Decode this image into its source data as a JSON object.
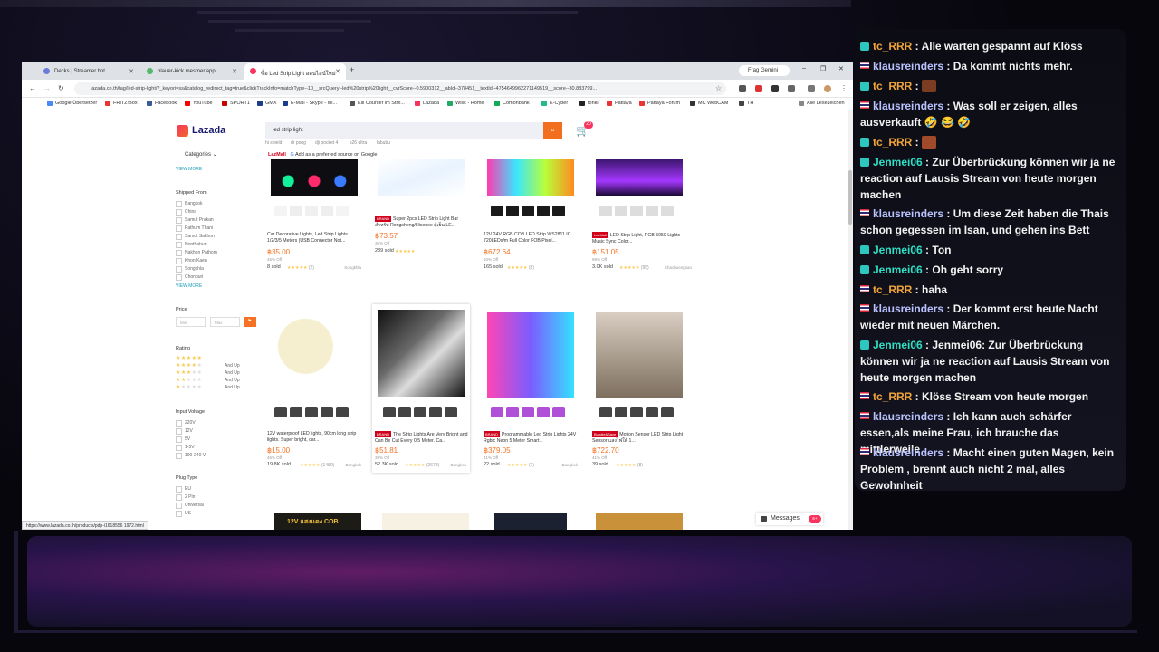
{
  "browser": {
    "tabs": [
      {
        "label": "Decks | Streamer.bot"
      },
      {
        "label": "blauer-kick.mesmer.app"
      },
      {
        "label": "ซื้อ Led Strip Light ออนไลน์ใหม่"
      }
    ],
    "new_tab": "+",
    "frag": "Frag Gemini",
    "window_controls": [
      "–",
      "❐",
      "✕"
    ],
    "url": "lazada.co.th/tag/led-strip-light/?_keyori=ss&catalog_redirect_tag=true&clickTrackInfo=matchType--10__srcQuery--led%20strip%20light__cvrScore--0.5900312__abId--378451__textId--4754649962271149519__score--30.883799...",
    "bookmarks": [
      "Google Übersetzer",
      "FRITZ!Box",
      "Facebook",
      "YouTube",
      "SPORT1",
      "GMX",
      "E-Mail - Skype - Mi...",
      "Kill Counter im Stre...",
      "Lazada",
      "Wisc - Home",
      "Comonbank",
      "K-Cyber",
      "fonkil",
      "Pattaya",
      "Pattaya Forum",
      "MC WebCAM",
      "TH"
    ],
    "bookmarks_all": "Alle Lesezeichen",
    "status_url": "https://www.lazada.co.th/products/pdp-i1618556 1972.html"
  },
  "lazada": {
    "logo": "Lazada",
    "search_value": "led strip light",
    "search_suggestions": [
      "hi shield",
      "dr pong",
      "dji pocket 4",
      "s26 ultra",
      "labubu"
    ],
    "categories": "Categories",
    "view_more": "VIEW MORE",
    "lazmall": "LazMall",
    "google_note": "Add as a preferred source on Google",
    "shipped_from": {
      "title": "Shipped From",
      "options": [
        "Bangkok",
        "China",
        "Samut Prakan",
        "Pathum Thani",
        "Samut Sakhon",
        "Nonthaburi",
        "Nakhon Pathom",
        "Khon Kaen",
        "Songkhla",
        "Chonburi"
      ]
    },
    "price": {
      "title": "Price",
      "min": "Min",
      "max": "Max",
      "go": "▸"
    },
    "rating": {
      "title": "Rating",
      "and_up": "And Up"
    },
    "input_voltage": {
      "title": "Input Voltage",
      "options": [
        "220V",
        "12V",
        "5V",
        "1-5V",
        "100-240 V"
      ]
    },
    "plug_type": {
      "title": "Plug Type",
      "options": [
        "EU",
        "2 Pin",
        "Universal",
        "US"
      ]
    },
    "cart_count": "20",
    "messages": {
      "label": "Messages",
      "count": "6+"
    },
    "products": [
      {
        "name": "Car Decorative Lights, Led Strip Lights 1/2/3/5 Meters (USB Connector Not...",
        "price": "฿35.00",
        "off": "45% Off",
        "sold": "8 sold",
        "reviews": "(2)",
        "loc": "Songkhla",
        "badge": ""
      },
      {
        "name": "Super 2pcs LED Strip Light Bar สำหรับ Rongsheng/Hisense ตู้เย็น LE...",
        "price": "฿73.57",
        "off": "36% Off",
        "sold": "239 sold",
        "reviews": "",
        "loc": "",
        "badge": "BRAND"
      },
      {
        "name": "12V 24V RGB COB LED Strip WS2811 IC 720LEDs/m Full Color FOB Pixel...",
        "price": "฿672.64",
        "off": "10% Off",
        "sold": "165 sold",
        "reviews": "(8)",
        "loc": "",
        "badge": ""
      },
      {
        "name": "LED Strip Light, RGB 5050 Lights Music Sync Color...",
        "price": "฿151.05",
        "off": "99% Off",
        "sold": "3.0K sold",
        "reviews": "(95)",
        "loc": "Chachoengsao",
        "badge": "LazMall"
      },
      {
        "name": "12V waterproof LED lights, 90cm long strip lights. Super bright, car...",
        "price": "฿15.00",
        "off": "46% Off",
        "sold": "19.8K sold",
        "reviews": "(1480)",
        "loc": "Bangkok",
        "badge": ""
      },
      {
        "name": "The Strip Lights Are Very Bright and Can Be Cut Every 0.5 Meter. Ca...",
        "price": "฿51.81",
        "off": "38% Off",
        "sold": "52.3K sold",
        "reviews": "(2678)",
        "loc": "Bangkok",
        "badge": "BRAND"
      },
      {
        "name": "Programmable Led Strip Lights 24V Rgbic Neon 5 Meter Smart...",
        "price": "฿379.05",
        "off": "41% Off",
        "sold": "22 sold",
        "reviews": "(7)",
        "loc": "Bangkok",
        "badge": "BRAND"
      },
      {
        "name": "Motion Sensor LED Strip Light Sensor แสงไฟใต้ 1...",
        "price": "฿722.70",
        "off": "41% Off",
        "sold": "39 sold",
        "reviews": "(8)",
        "loc": "",
        "badge": "Bundle&Save"
      }
    ],
    "bottom_row": [
      "12V แสงแดง COB",
      "",
      "",
      ""
    ]
  },
  "chat": [
    {
      "flag": "badge",
      "user": "tc_RRR",
      "text": "Alle warten gespannt auf Klöss",
      "cls": "user-tc"
    },
    {
      "flag": "flag",
      "user": "klausreinders",
      "text": "Da kommt nichts mehr.",
      "cls": "user-kl"
    },
    {
      "flag": "badge",
      "user": "tc_RRR",
      "text": "",
      "cls": "user-tc",
      "emote": "img"
    },
    {
      "flag": "flag",
      "user": "klausreinders",
      "text": "Was soll er zeigen, alles ausverkauft 🤣 😂 🤣",
      "cls": "user-kl"
    },
    {
      "flag": "badge",
      "user": "tc_RRR",
      "text": "",
      "cls": "user-tc",
      "emote": "img"
    },
    {
      "flag": "badge",
      "user": "Jenmei06",
      "text": "Zur Überbrückung können wir ja ne reaction auf Lausis Stream von heute morgen machen",
      "cls": "user-je"
    },
    {
      "flag": "flag",
      "user": "klausreinders",
      "text": "Um diese Zeit haben die Thais schon gegessen im Isan, und gehen ins Bett",
      "cls": "user-kl"
    },
    {
      "flag": "badge",
      "user": "Jenmei06",
      "text": "Ton",
      "cls": "user-je"
    },
    {
      "flag": "badge",
      "user": "Jenmei06",
      "text": "Oh geht sorry",
      "cls": "user-je"
    },
    {
      "flag": "badge",
      "user": "tc_RRR",
      "text": "haha",
      "cls": "user-tc"
    },
    {
      "flag": "flag",
      "user": "klausreinders",
      "text": "Der kommt erst heute Nacht wieder mit neuen Märchen.",
      "cls": "user-kl"
    },
    {
      "flag": "badge",
      "user": "Jenmei06",
      "text": "Jenmei06: Zur Überbrückung können wir ja ne reaction auf Lausis Stream von heute morgen machen",
      "cls": "user-je"
    },
    {
      "flag": "badge",
      "user": "tc_RRR",
      "text": "Klöss Stream von heute morgen",
      "cls": "user-tc"
    },
    {
      "flag": "flag",
      "user": "klausreinders",
      "text": "Ich kann auch schärfer essen,als meine Frau, ich brauche das mittlerweile",
      "cls": "user-kl"
    },
    {
      "flag": "flag",
      "user": "klausreinders",
      "text": "Macht einen guten Magen, kein Problem , brennt auch nicht 2 mal, alles Gewohnheit",
      "cls": "user-kl"
    }
  ]
}
